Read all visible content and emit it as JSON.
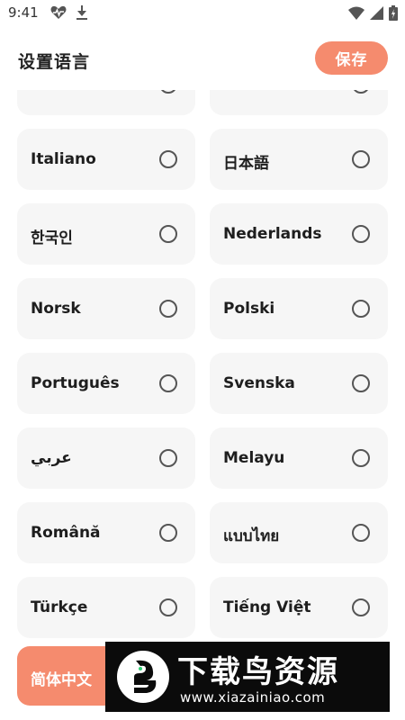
{
  "status_bar": {
    "time": "9:41",
    "left_icons": [
      "heart-pulse-icon",
      "download-icon"
    ],
    "right_icons": [
      "wifi-icon",
      "signal-icon",
      "battery-icon"
    ]
  },
  "header": {
    "title": "设置语言",
    "save_label": "保存"
  },
  "languages": [
    {
      "label": ""
    },
    {
      "label": ""
    },
    {
      "label": "Italiano"
    },
    {
      "label": "日本語"
    },
    {
      "label": "한국인"
    },
    {
      "label": "Nederlands"
    },
    {
      "label": "Norsk"
    },
    {
      "label": "Polski"
    },
    {
      "label": "Português"
    },
    {
      "label": "Svenska"
    },
    {
      "label": "عربي"
    },
    {
      "label": "Melayu"
    },
    {
      "label": "Română"
    },
    {
      "label": "แบบไทย"
    },
    {
      "label": "Türkçe"
    },
    {
      "label": "Tiếng Việt"
    }
  ],
  "selected_language": {
    "label": "简体中文"
  },
  "watermark": {
    "title": "下载鸟资源",
    "url": "www.xiazainiao.com"
  },
  "colors": {
    "accent": "#f58b6e",
    "card_bg": "#f6f6f6",
    "watermark_bg": "#0b0b0b"
  }
}
